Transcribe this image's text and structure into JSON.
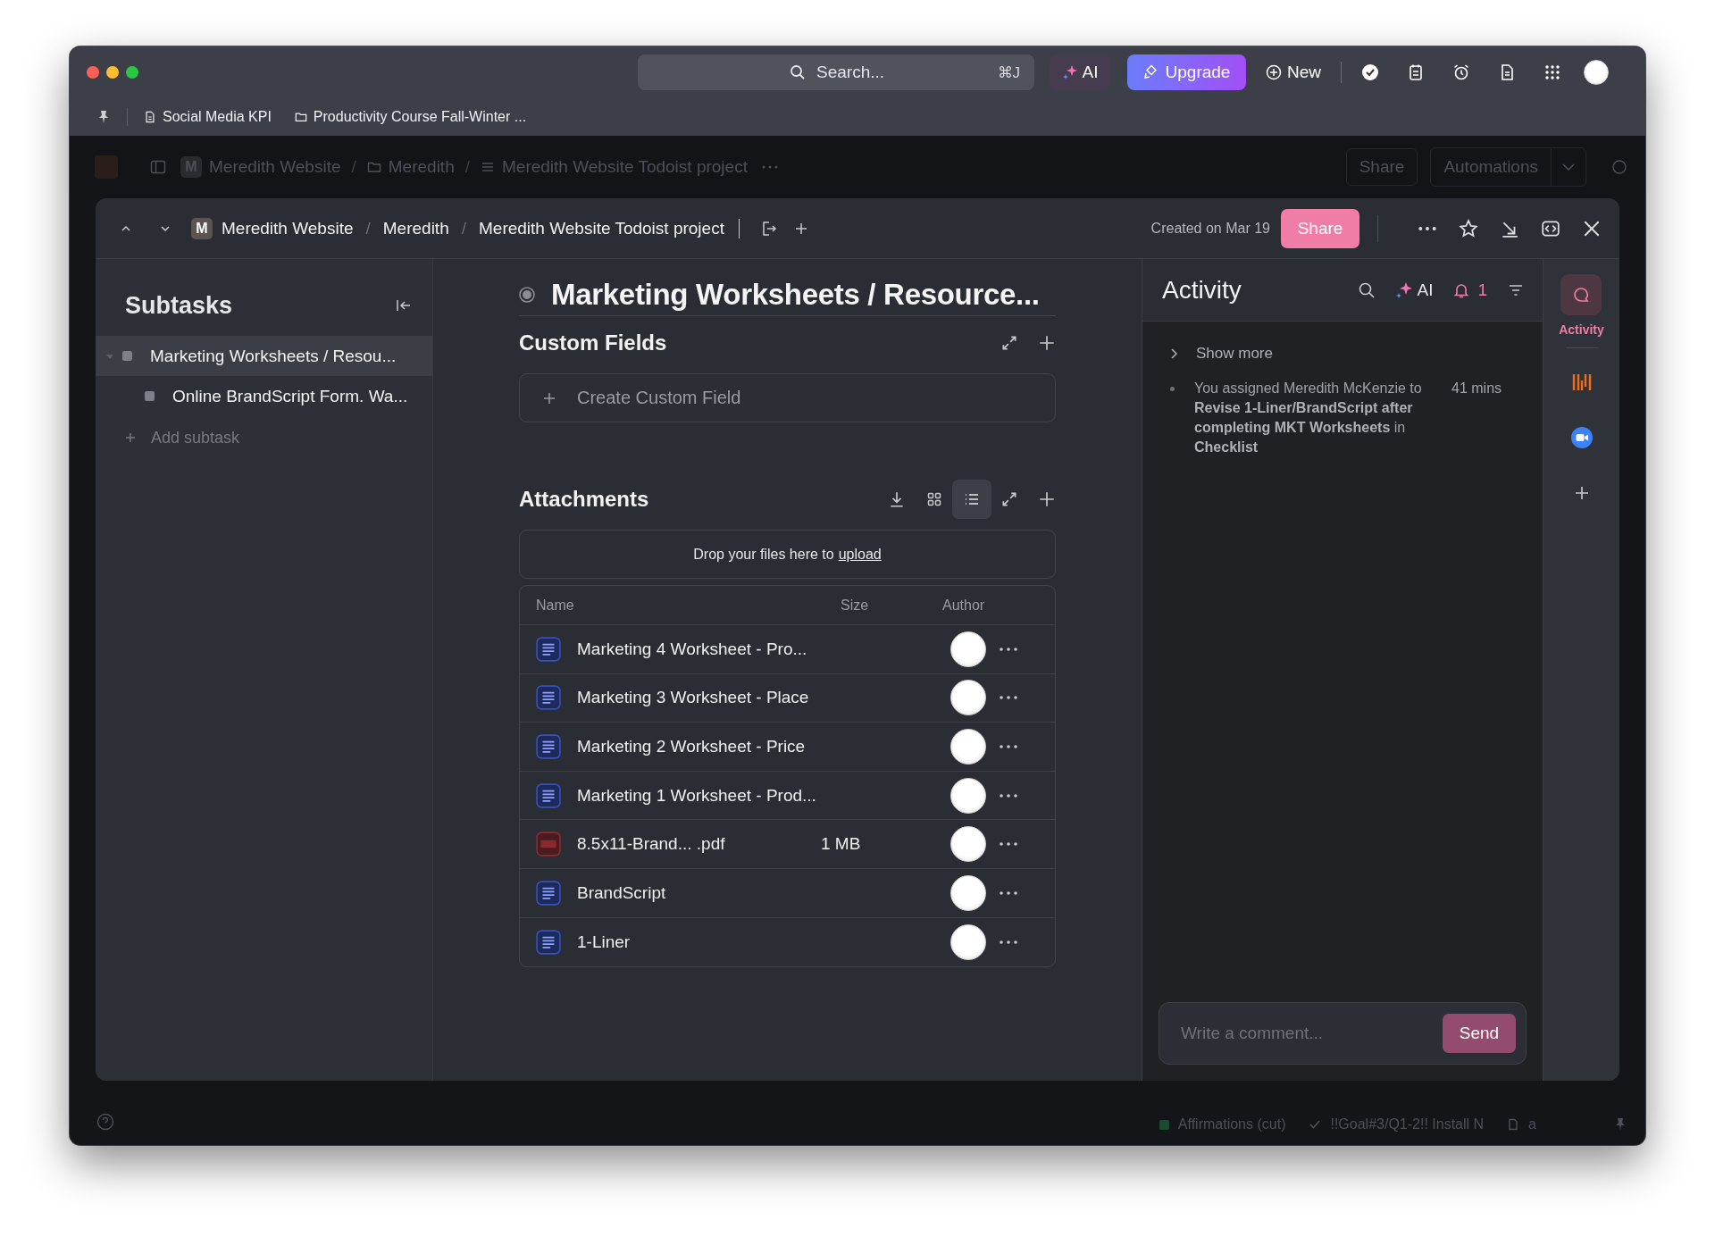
{
  "top_bar": {
    "search": {
      "placeholder": "Search...",
      "shortcut": "⌘J"
    },
    "ai_button": "AI",
    "upgrade_button": "Upgrade",
    "new_button": "New"
  },
  "favorites": [
    {
      "kind": "doc",
      "label": "Social Media KPI"
    },
    {
      "kind": "folder",
      "label": "Productivity Course Fall-Winter ..."
    }
  ],
  "background_header": {
    "breadcrumbs": [
      {
        "kind": "space",
        "badge": "M",
        "label": "Meredith Website"
      },
      {
        "kind": "folder",
        "label": "Meredith"
      },
      {
        "kind": "list",
        "label": "Meredith Website Todoist project"
      }
    ],
    "separator": "/",
    "share_button": "Share",
    "automations_button": "Automations"
  },
  "modal": {
    "breadcrumbs": [
      {
        "kind": "space",
        "badge": "M",
        "label": "Meredith Website"
      },
      {
        "kind": "folder",
        "label": "Meredith"
      },
      {
        "kind": "list",
        "label": "Meredith Website Todoist project"
      }
    ],
    "separator": "/",
    "created": "Created on Mar 19",
    "share_button": "Share"
  },
  "subtasks": {
    "title": "Subtasks",
    "items": [
      {
        "label": "Marketing Worksheets / Resou...",
        "selected": true,
        "expanded": true,
        "children": [
          {
            "label": "Online BrandScript Form. Wa...",
            "selected": false
          }
        ]
      }
    ],
    "add_label": "Add subtask"
  },
  "task": {
    "title": "Marketing Worksheets / Resource...",
    "custom_fields": {
      "title": "Custom Fields",
      "create_label": "Create Custom Field"
    },
    "attachments": {
      "title": "Attachments",
      "views": [
        {
          "kind": "grid",
          "selected": false
        },
        {
          "kind": "list",
          "selected": true
        }
      ],
      "drop_text": "Drop your files here to",
      "drop_link": "upload",
      "columns": [
        "Name",
        "Size",
        "Author"
      ],
      "rows": [
        {
          "kind": "doc",
          "name": "Marketing 4 Worksheet - Pro..."
        },
        {
          "kind": "doc",
          "name": "Marketing 3 Worksheet - Place"
        },
        {
          "kind": "doc",
          "name": "Marketing 2 Worksheet - Price"
        },
        {
          "kind": "doc",
          "name": "Marketing 1 Worksheet - Prod..."
        },
        {
          "kind": "pdf",
          "name": "8.5x11-Brand...  .pdf",
          "size": "1 MB"
        },
        {
          "kind": "doc",
          "name": "BrandScript"
        },
        {
          "kind": "doc",
          "name": "1-Liner"
        }
      ]
    }
  },
  "activity": {
    "title": "Activity",
    "ai_label": "AI",
    "notifications": "1",
    "show_more": "Show more",
    "entries": [
      {
        "text": "You  assigned Meredith McKenzie to **Revise 1-Liner/BrandScript after completing MKT Worksheets** in **Checklist**",
        "time": "41 mins"
      }
    ],
    "comment": {
      "placeholder": "Write a comment...",
      "send": "Send"
    }
  },
  "rail": [
    {
      "kind": "activity",
      "label": "Activity",
      "selected": true
    },
    {
      "kind": "app",
      "selected": false
    },
    {
      "kind": "video",
      "selected": false
    },
    {
      "kind": "add",
      "selected": false
    }
  ],
  "status_bar": {
    "items": [
      {
        "kind": "list",
        "label": "Affirmations (cut)"
      },
      {
        "kind": "check",
        "label": "!!Goal#3/Q1-2!! Install N"
      },
      {
        "kind": "doc",
        "label": "a"
      }
    ]
  }
}
